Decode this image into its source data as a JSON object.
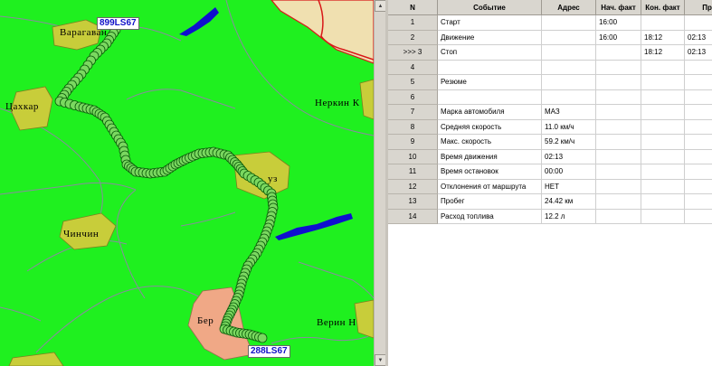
{
  "map": {
    "places": [
      {
        "id": "varagavan",
        "label": "Варагаван"
      },
      {
        "id": "tsakhkar",
        "label": "Цахкар"
      },
      {
        "id": "nerkin",
        "label": "Неркин К"
      },
      {
        "id": "chinchin",
        "label": "Чинчин"
      },
      {
        "id": "uz",
        "label": "уз"
      },
      {
        "id": "ber",
        "label": "Бер"
      },
      {
        "id": "verin",
        "label": "Верин Н"
      }
    ],
    "vehicles": [
      {
        "id": "veh1",
        "plate": "899LS67"
      },
      {
        "id": "veh2",
        "plate": "288LS67"
      }
    ],
    "colors": {
      "land": "#1ff01f",
      "settlement": "#c8cd3a",
      "town": "#f0a886",
      "water": "#0f0fcf",
      "track": "#17b51a",
      "road": "#8a8aa0",
      "border": "#d81818"
    }
  },
  "scrollbar": {
    "up_icon": "▲",
    "down_icon": "▼"
  },
  "table": {
    "headers": [
      "N",
      "Событие",
      "Адрес",
      "Нач. факт",
      "Кон. факт",
      "Прод"
    ],
    "rows": [
      {
        "n": "1",
        "event": "Старт",
        "address": "",
        "start": "16:00",
        "end": "",
        "duration": ""
      },
      {
        "n": "2",
        "event": "Движение",
        "address": "",
        "start": "16:00",
        "end": "18:12",
        "duration": "02:13"
      },
      {
        "n": ">>> 3",
        "event": "Стоп",
        "address": "",
        "start": "",
        "end": "18:12",
        "duration": "02:13"
      },
      {
        "n": "4",
        "event": "",
        "address": "",
        "start": "",
        "end": "",
        "duration": ""
      },
      {
        "n": "5",
        "event": "Резюме",
        "address": "",
        "start": "",
        "end": "",
        "duration": ""
      },
      {
        "n": "6",
        "event": "",
        "address": "",
        "start": "",
        "end": "",
        "duration": ""
      },
      {
        "n": "7",
        "event": "Марка автомобиля",
        "address": "МАЗ",
        "start": "",
        "end": "",
        "duration": ""
      },
      {
        "n": "8",
        "event": "Средняя скорость",
        "address": "11.0 км/ч",
        "start": "",
        "end": "",
        "duration": ""
      },
      {
        "n": "9",
        "event": "Макс. скорость",
        "address": "59.2 км/ч",
        "start": "",
        "end": "",
        "duration": ""
      },
      {
        "n": "10",
        "event": "Время движения",
        "address": "02:13",
        "start": "",
        "end": "",
        "duration": ""
      },
      {
        "n": "11",
        "event": "Время остановок",
        "address": "00:00",
        "start": "",
        "end": "",
        "duration": ""
      },
      {
        "n": "12",
        "event": "Отклонения от маршрута",
        "address": "НЕТ",
        "start": "",
        "end": "",
        "duration": ""
      },
      {
        "n": "13",
        "event": "Пробег",
        "address": "24.42 км",
        "start": "",
        "end": "",
        "duration": ""
      },
      {
        "n": "14",
        "event": "Расход топлива",
        "address": "12.2 л",
        "start": "",
        "end": "",
        "duration": ""
      }
    ]
  }
}
